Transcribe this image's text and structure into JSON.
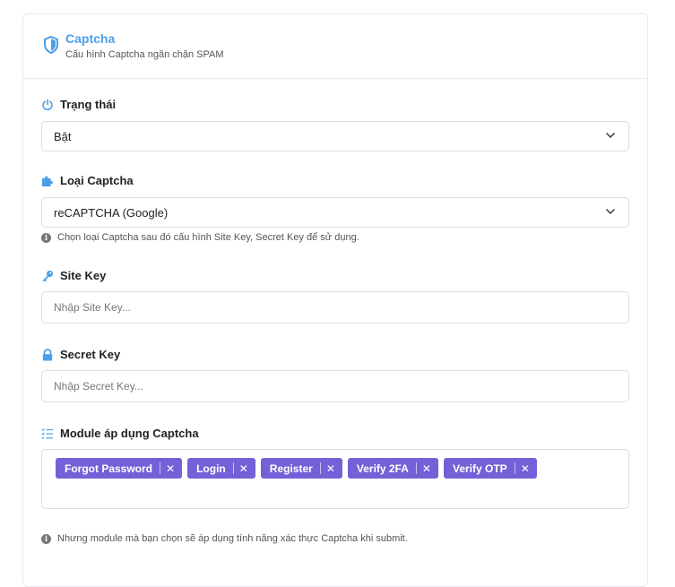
{
  "header": {
    "title": "Captcha",
    "subtitle": "Cấu hình Captcha ngăn chặn SPAM",
    "icon": "shield-icon"
  },
  "status": {
    "label": "Trạng thái",
    "icon": "power-icon",
    "value": "Bật"
  },
  "captcha_type": {
    "label": "Loại Captcha",
    "icon": "puzzle-icon",
    "value": "reCAPTCHA (Google)",
    "help": "Chọn loại Captcha sau đó cấu hình Site Key, Secret Key để sử dụng."
  },
  "site_key": {
    "label": "Site Key",
    "icon": "key-icon",
    "value": "",
    "placeholder": "Nhập Site Key..."
  },
  "secret_key": {
    "label": "Secret Key",
    "icon": "lock-icon",
    "value": "",
    "placeholder": "Nhập Secret Key..."
  },
  "modules": {
    "label": "Module áp dụng Captcha",
    "icon": "list-check-icon",
    "tags": [
      {
        "label": "Forgot Password"
      },
      {
        "label": "Login"
      },
      {
        "label": "Register"
      },
      {
        "label": "Verify 2FA"
      },
      {
        "label": "Verify OTP"
      }
    ],
    "remove_glyph": "✕",
    "help": "Nhưng module mà bạn chọn sẽ áp dụng tính năng xác thực Captcha khi submit."
  },
  "colors": {
    "accent": "#4a9ee8",
    "tag": "#7660d8"
  }
}
